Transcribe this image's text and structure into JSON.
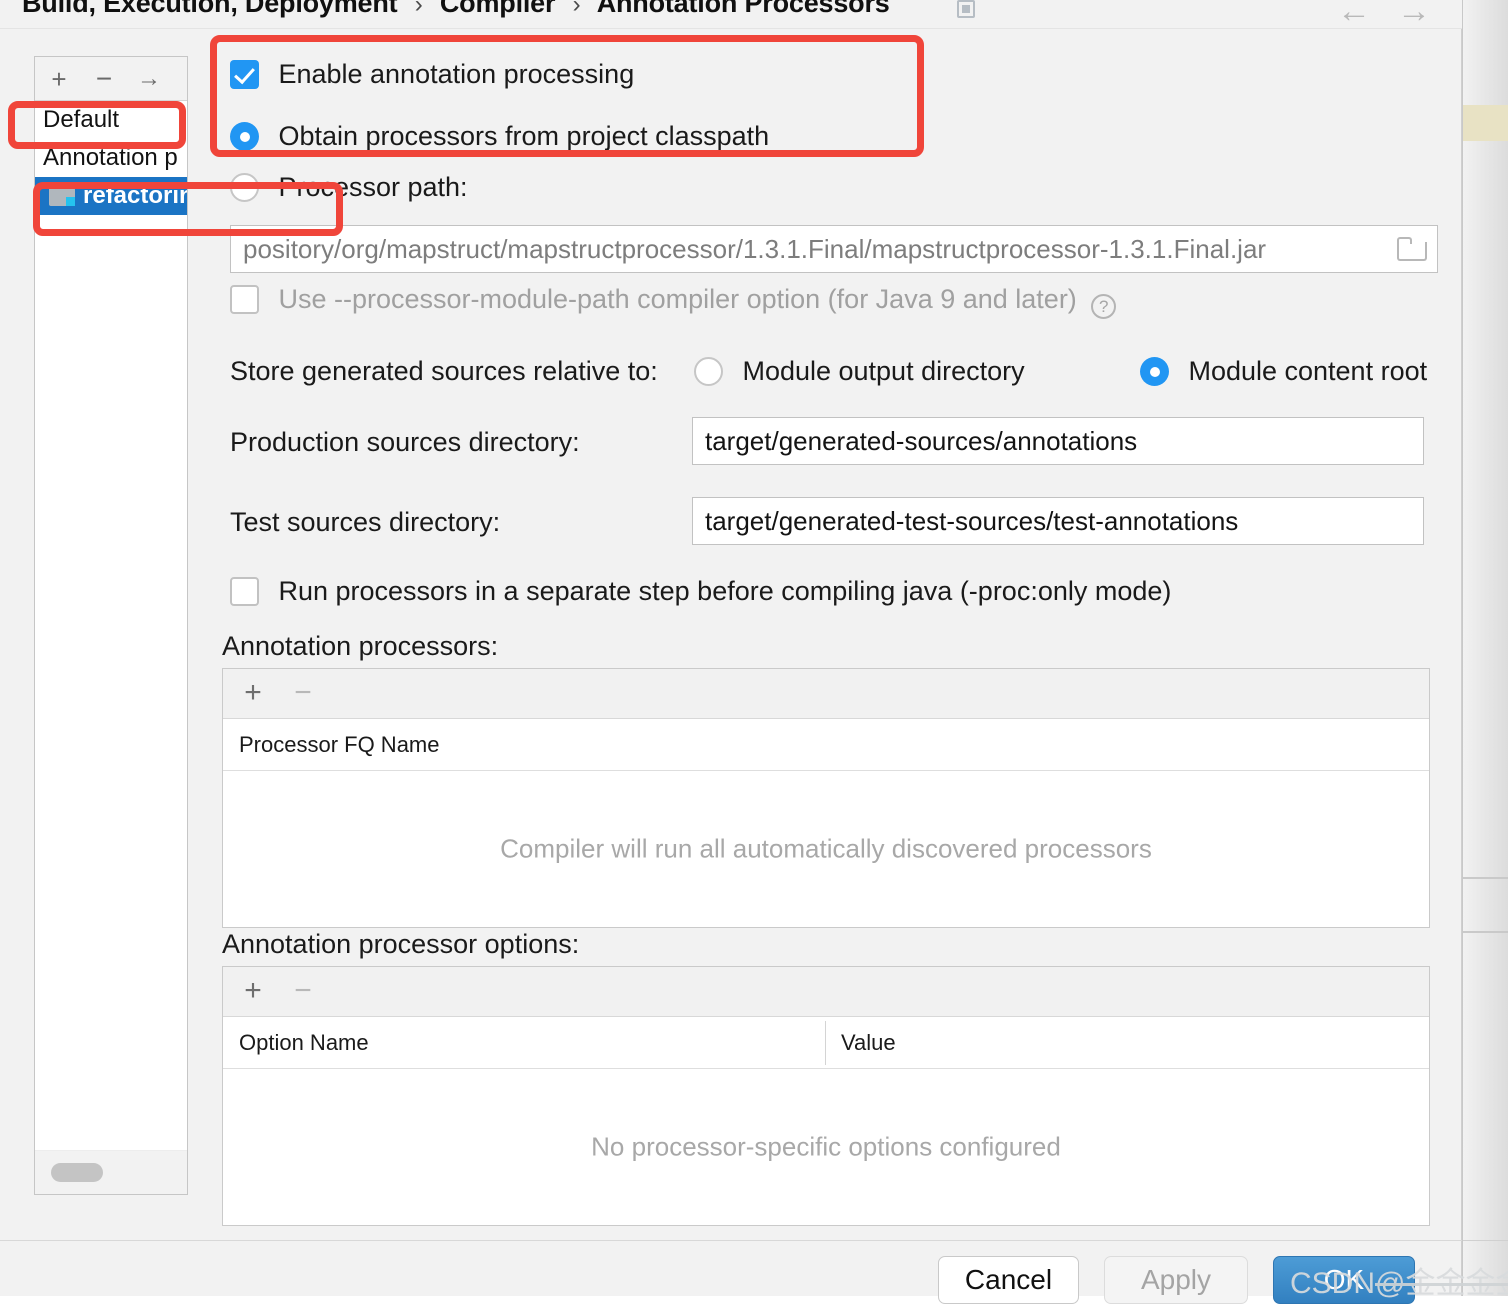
{
  "header": {
    "breadcrumb": [
      "Build, Execution, Deployment",
      "Compiler",
      "Annotation Processors"
    ],
    "separator": "›",
    "back_arrow": "←",
    "forward_arrow": "→"
  },
  "left_panel": {
    "toolbar": {
      "add": "+",
      "remove": "−",
      "move": "→"
    },
    "items": [
      {
        "label": "Default",
        "selected": false,
        "icon": "none"
      },
      {
        "label": "Annotation p",
        "selected": false,
        "icon": "none"
      },
      {
        "label": "refactoringcode",
        "selected": true,
        "icon": "folder-icon"
      }
    ]
  },
  "main": {
    "enable_annotation_processing": {
      "label": "Enable annotation processing",
      "checked": true
    },
    "source_mode": {
      "option_classpath": "Obtain processors from project classpath",
      "option_processor_path": "Processor path:",
      "selected": "classpath"
    },
    "processor_path": {
      "value": "pository/org/mapstruct/mapstructprocessor/1.3.1.Final/mapstructprocessor-1.3.1.Final.jar",
      "browse_icon": "folder-browse-icon"
    },
    "module_path_option": {
      "label": "Use --processor-module-path compiler option (for Java 9 and later)",
      "checked": false,
      "help_glyph": "?"
    },
    "store_sources": {
      "label": "Store generated sources relative to:",
      "option_output": "Module output directory",
      "option_content_root": "Module content root",
      "selected": "content_root"
    },
    "production_sources": {
      "label": "Production sources directory:",
      "value": "target/generated-sources/annotations"
    },
    "test_sources": {
      "label": "Test sources directory:",
      "value": "target/generated-test-sources/test-annotations"
    },
    "separate_step": {
      "label": "Run processors in a separate step before compiling java (-proc:only mode)",
      "checked": false
    },
    "processors_table": {
      "label": "Annotation processors:",
      "toolbar": {
        "add": "+",
        "remove": "−"
      },
      "columns": [
        "Processor FQ Name"
      ],
      "rows": [],
      "empty_message": "Compiler will run all automatically discovered processors"
    },
    "options_table": {
      "label": "Annotation processor options:",
      "toolbar": {
        "add": "+",
        "remove": "−"
      },
      "columns": [
        "Option Name",
        "Value"
      ],
      "rows": [],
      "empty_message": "No processor-specific options configured"
    }
  },
  "footer": {
    "cancel": "Cancel",
    "apply": "Apply",
    "ok": "OK"
  },
  "watermark": {
    "prefix": "CSDN",
    "handle": "@金金金金丝猴"
  },
  "colors": {
    "accent_blue": "#2196f3",
    "selection_blue": "#1b74c4",
    "ok_button_blue": "#3280c0",
    "annotation_red": "#f0453a",
    "dialog_background": "#f2f2f2"
  }
}
